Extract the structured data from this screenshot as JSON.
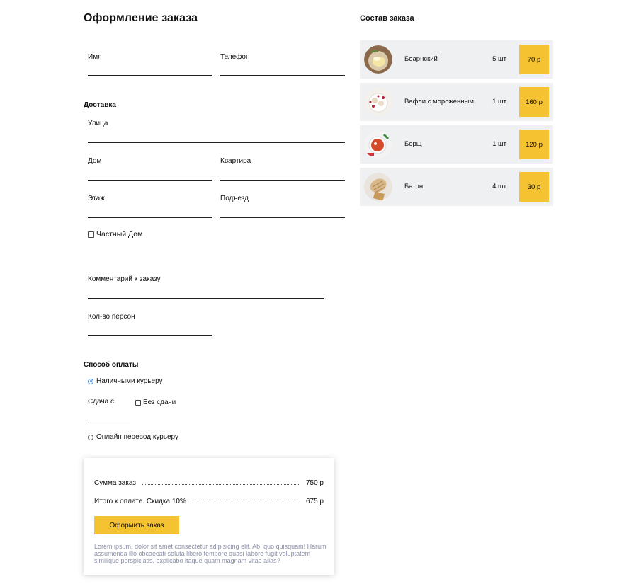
{
  "form": {
    "title": "Оформление заказа",
    "name_label": "Имя",
    "phone_label": "Телефон",
    "delivery_title": "Доставка",
    "street_label": "Улица",
    "house_label": "Дом",
    "apartment_label": "Квартира",
    "floor_label": "Этаж",
    "entrance_label": "Подъезд",
    "private_house_label": "Частный Дом",
    "comment_label": "Комментарий к заказу",
    "persons_label": "Кол-во персон",
    "payment_title": "Способ оплаты",
    "cash_label": "Наличными курьеру",
    "change_label": "Сдача с",
    "no_change_label": "Без сдачи",
    "online_label": "Онлайн перевод курьеру"
  },
  "summary": {
    "sum_label": "Сумма заказ",
    "sum_value": "750 р",
    "total_label": "Итого к оплате. Скидка 10%",
    "total_value": "675 р",
    "submit_label": "Оформить заказ",
    "note": "Lorem ipsum, dolor sit amet consectetur adipisicing elit. Ab, quo quisquam! Harum assumenda illo obcaecati soluta libero tempore quasi labore fugit voluptatem similique perspiciatis, explicabo itaque quam magnam vitae alias?"
  },
  "order": {
    "title": "Состав заказа",
    "items": [
      {
        "name": "Беарнский",
        "qty": "5 шт",
        "price": "70 р"
      },
      {
        "name": "Вафли с мороженным",
        "qty": "1 шт",
        "price": "160 р"
      },
      {
        "name": "Борщ",
        "qty": "1 шт",
        "price": "120 р"
      },
      {
        "name": "Батон",
        "qty": "4 шт",
        "price": "30 р"
      }
    ]
  },
  "colors": {
    "accent": "#f5c331",
    "item_bg": "#eef0f2",
    "radio_active": "#4a90d9",
    "note_text": "#8b8fa8"
  }
}
